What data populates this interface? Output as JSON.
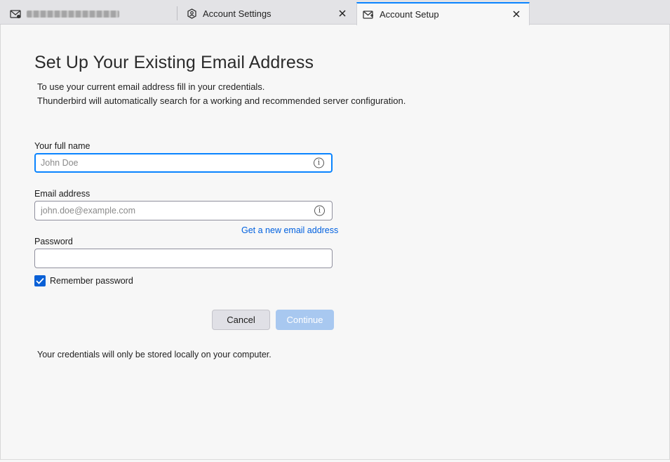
{
  "tabs": [
    {
      "label": "",
      "icon": "mail-icon",
      "active": false
    },
    {
      "label": "Account Settings",
      "icon": "settings-shield-icon",
      "active": false
    },
    {
      "label": "Account Setup",
      "icon": "mail-setup-icon",
      "active": true
    }
  ],
  "page": {
    "title": "Set Up Your Existing Email Address",
    "intro_line1": "To use your current email address fill in your credentials.",
    "intro_line2": "Thunderbird will automatically search for a working and recommended server configuration."
  },
  "form": {
    "name_label": "Your full name",
    "name_value": "",
    "name_placeholder": "John Doe",
    "email_label": "Email address",
    "email_value": "",
    "email_placeholder": "john.doe@example.com",
    "get_new_email_link": "Get a new email address",
    "password_label": "Password",
    "password_value": "",
    "remember_password_label": "Remember password",
    "remember_password_checked": true
  },
  "buttons": {
    "cancel_label": "Cancel",
    "continue_label": "Continue"
  },
  "footer": {
    "note": "Your credentials will only be stored locally on your computer."
  },
  "colors": {
    "accent": "#0a84ff",
    "link": "#0060df",
    "checkbox": "#0a60d6",
    "continue_disabled": "#a8c8f0"
  }
}
